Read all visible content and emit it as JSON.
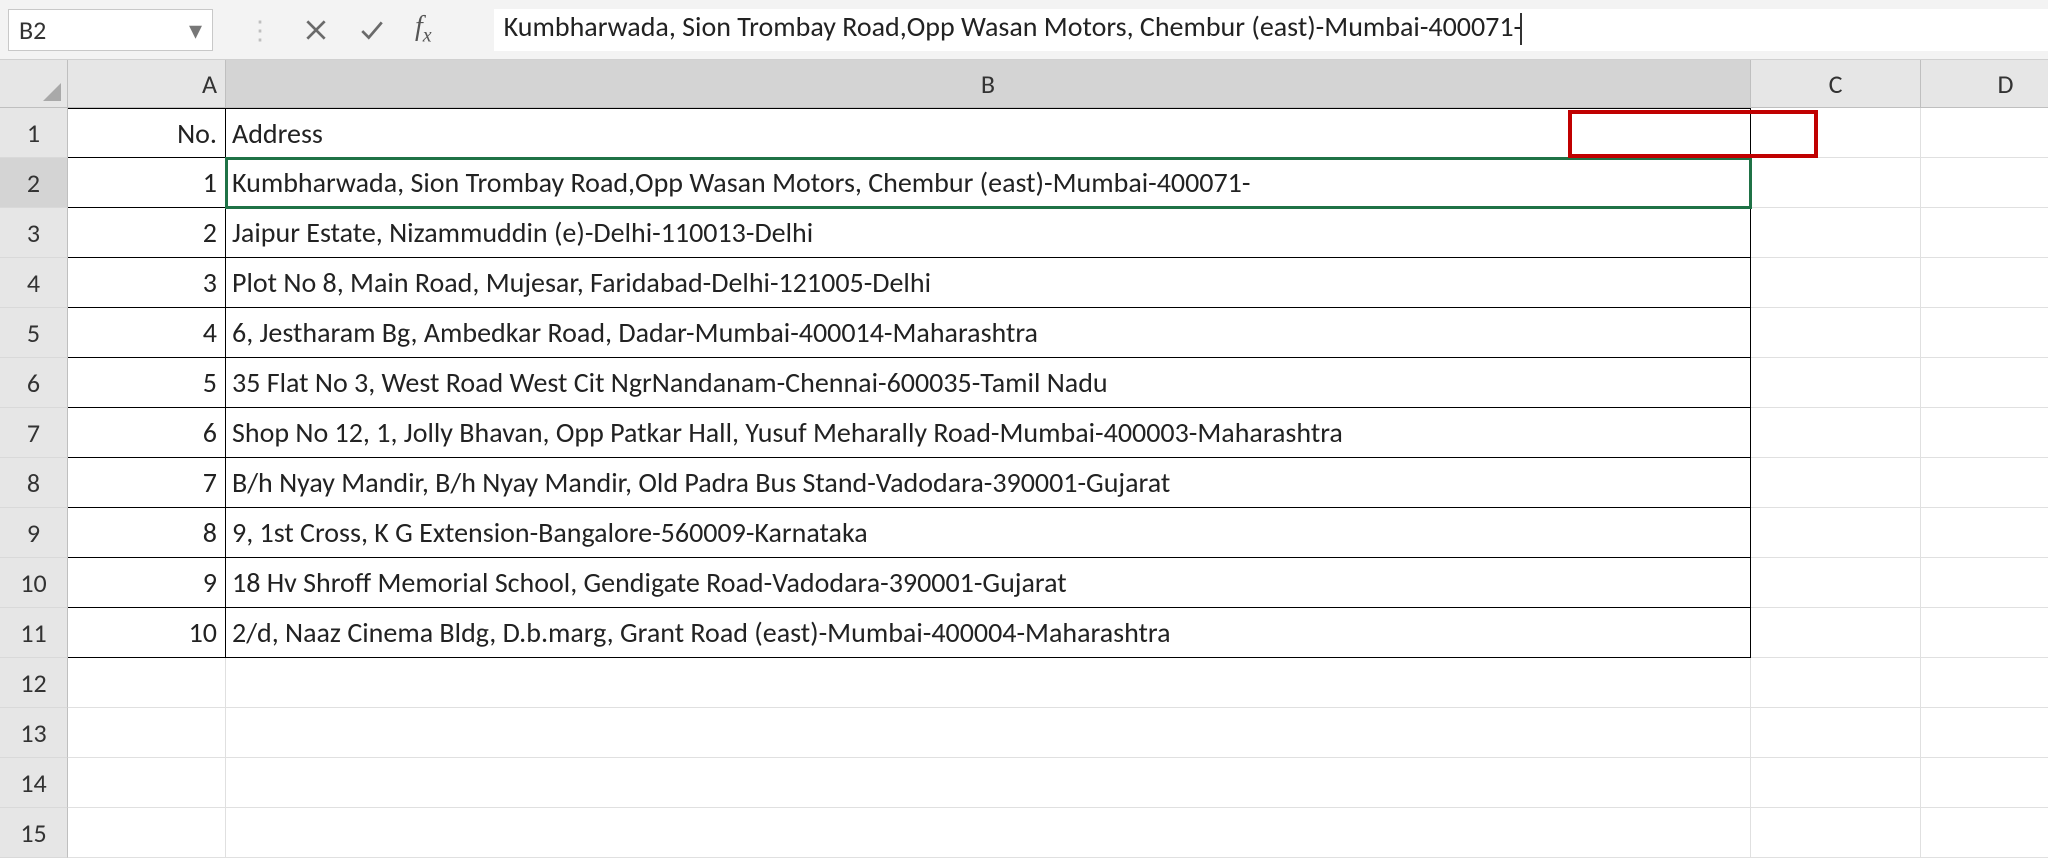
{
  "nameBox": "B2",
  "formula": "Kumbharwada, Sion Trombay Road,Opp Wasan Motors, Chembur (east)-Mumbai-400071-",
  "columns": [
    "A",
    "B",
    "C",
    "D"
  ],
  "headers": {
    "A": "No.",
    "B": "Address"
  },
  "rows": [
    {
      "no": "1",
      "addr": "Kumbharwada, Sion Trombay Road,Opp Wasan Motors, Chembur (east)-Mumbai-400071-"
    },
    {
      "no": "2",
      "addr": "Jaipur Estate, Nizammuddin (e)-Delhi-110013-Delhi"
    },
    {
      "no": "3",
      "addr": "Plot No 8, Main Road, Mujesar, Faridabad-Delhi-121005-Delhi"
    },
    {
      "no": "4",
      "addr": "6, Jestharam Bg, Ambedkar Road, Dadar-Mumbai-400014-Maharashtra"
    },
    {
      "no": "5",
      "addr": "35 Flat No 3, West Road West Cit NgrNandanam-Chennai-600035-Tamil Nadu"
    },
    {
      "no": "6",
      "addr": "Shop No 12, 1, Jolly Bhavan, Opp Patkar Hall, Yusuf Meharally Road-Mumbai-400003-Maharashtra"
    },
    {
      "no": "7",
      "addr": "B/h Nyay Mandir, B/h Nyay Mandir, Old Padra Bus Stand-Vadodara-390001-Gujarat"
    },
    {
      "no": "8",
      "addr": "9, 1st Cross, K G Extension-Bangalore-560009-Karnataka"
    },
    {
      "no": "9",
      "addr": "18 Hv Shroff Memorial School, Gendigate Road-Vadodara-390001-Gujarat"
    },
    {
      "no": "10",
      "addr": "2/d, Naaz Cinema Bldg, D.b.marg, Grant Road (east)-Mumbai-400004-Maharashtra"
    }
  ],
  "emptyRows": 4,
  "activeCellRef": "B2",
  "icons": {
    "dropdown": "▾"
  }
}
